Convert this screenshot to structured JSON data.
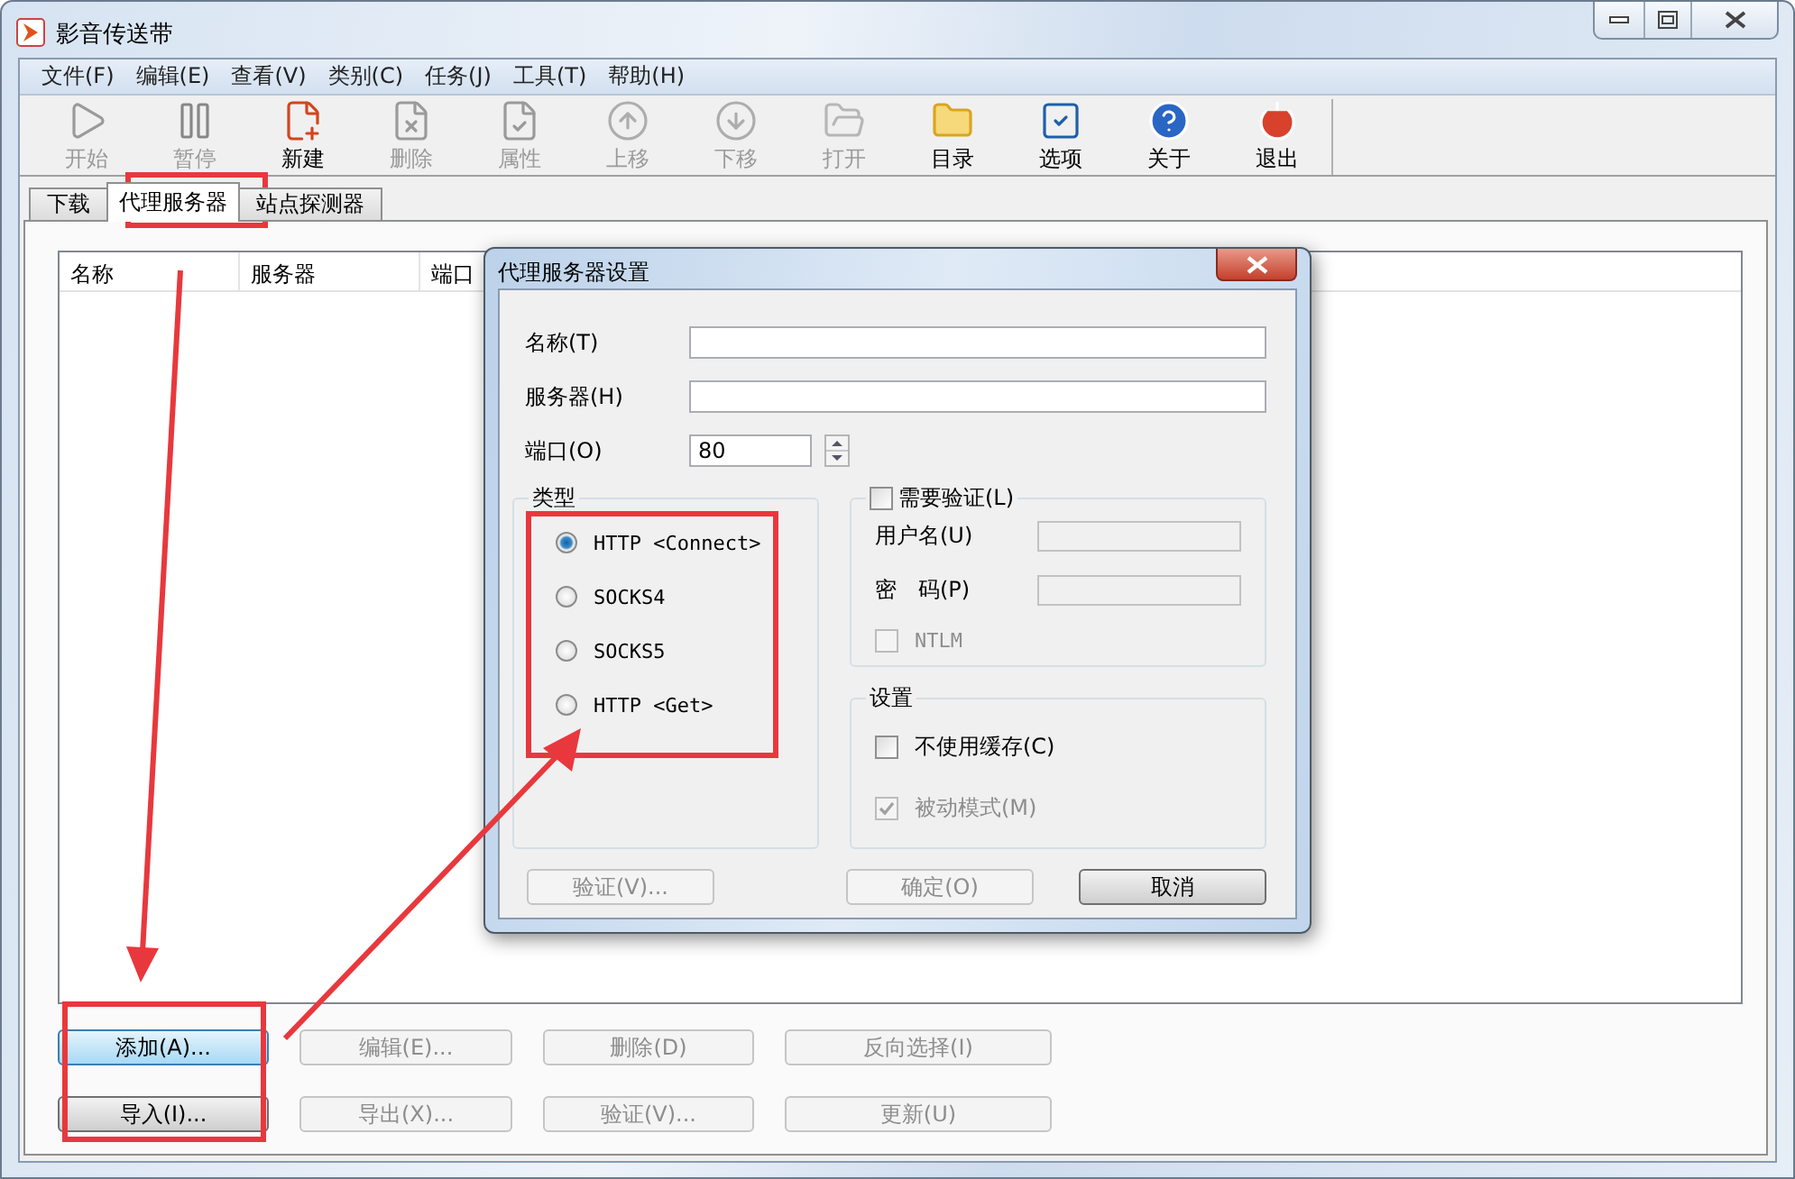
{
  "window": {
    "title": "影音传送带"
  },
  "menu": [
    "文件(F)",
    "编辑(E)",
    "查看(V)",
    "类别(C)",
    "任务(J)",
    "工具(T)",
    "帮助(H)"
  ],
  "toolbar": [
    {
      "label": "开始",
      "disabled": true
    },
    {
      "label": "暂停",
      "disabled": true
    },
    {
      "label": "新建",
      "disabled": false
    },
    {
      "label": "删除",
      "disabled": true
    },
    {
      "label": "属性",
      "disabled": true
    },
    {
      "label": "上移",
      "disabled": true
    },
    {
      "label": "下移",
      "disabled": true
    },
    {
      "label": "打开",
      "disabled": true
    },
    {
      "label": "目录",
      "disabled": false
    },
    {
      "label": "选项",
      "disabled": false
    },
    {
      "label": "关于",
      "disabled": false
    },
    {
      "label": "退出",
      "disabled": false
    }
  ],
  "tabs": [
    {
      "label": "下载",
      "selected": false
    },
    {
      "label": "代理服务器",
      "selected": true
    },
    {
      "label": "站点探测器",
      "selected": false
    }
  ],
  "list": {
    "columns": [
      "名称",
      "服务器",
      "端口"
    ]
  },
  "actions": [
    [
      {
        "label": "添加(A)...",
        "disabled": false,
        "focused": true
      },
      {
        "label": "编辑(E)...",
        "disabled": true,
        "focused": false
      },
      {
        "label": "删除(D)",
        "disabled": true,
        "focused": false
      },
      {
        "label": "反向选择(I)",
        "disabled": true,
        "focused": false
      }
    ],
    [
      {
        "label": "导入(I)...",
        "disabled": false,
        "focused": false
      },
      {
        "label": "导出(X)...",
        "disabled": true,
        "focused": false
      },
      {
        "label": "验证(V)...",
        "disabled": true,
        "focused": false
      },
      {
        "label": "更新(U)",
        "disabled": true,
        "focused": false
      }
    ]
  ],
  "dialog": {
    "title": "代理服务器设置",
    "fields": [
      {
        "label": "名称(T)"
      },
      {
        "label": "服务器(H)"
      }
    ],
    "port": {
      "label": "端口(O)",
      "value": "80"
    },
    "type_group": {
      "title": "类型",
      "options": [
        {
          "label": "HTTP <Connect>",
          "selected": true
        },
        {
          "label": "SOCKS4",
          "selected": false
        },
        {
          "label": "SOCKS5",
          "selected": false
        },
        {
          "label": "HTTP <Get>",
          "selected": false
        }
      ]
    },
    "auth_group": {
      "label": "需要验证(L)",
      "checked": false,
      "fields": [
        {
          "label": "用户名(U)",
          "disabled": true
        },
        {
          "label": "密　码(P)",
          "disabled": true
        }
      ],
      "ntlm": {
        "label": "NTLM",
        "checked": false,
        "disabled": true
      }
    },
    "settings_group": {
      "title": "设置",
      "options": [
        {
          "label": "不使用缓存(C)",
          "checked": false,
          "disabled": false
        },
        {
          "label": "被动模式(M)",
          "checked": true,
          "disabled": true
        }
      ]
    },
    "buttons": [
      {
        "label": "验证(V)...",
        "disabled": true
      },
      {
        "label": "确定(O)",
        "disabled": true
      },
      {
        "label": "取消",
        "disabled": false
      }
    ]
  }
}
